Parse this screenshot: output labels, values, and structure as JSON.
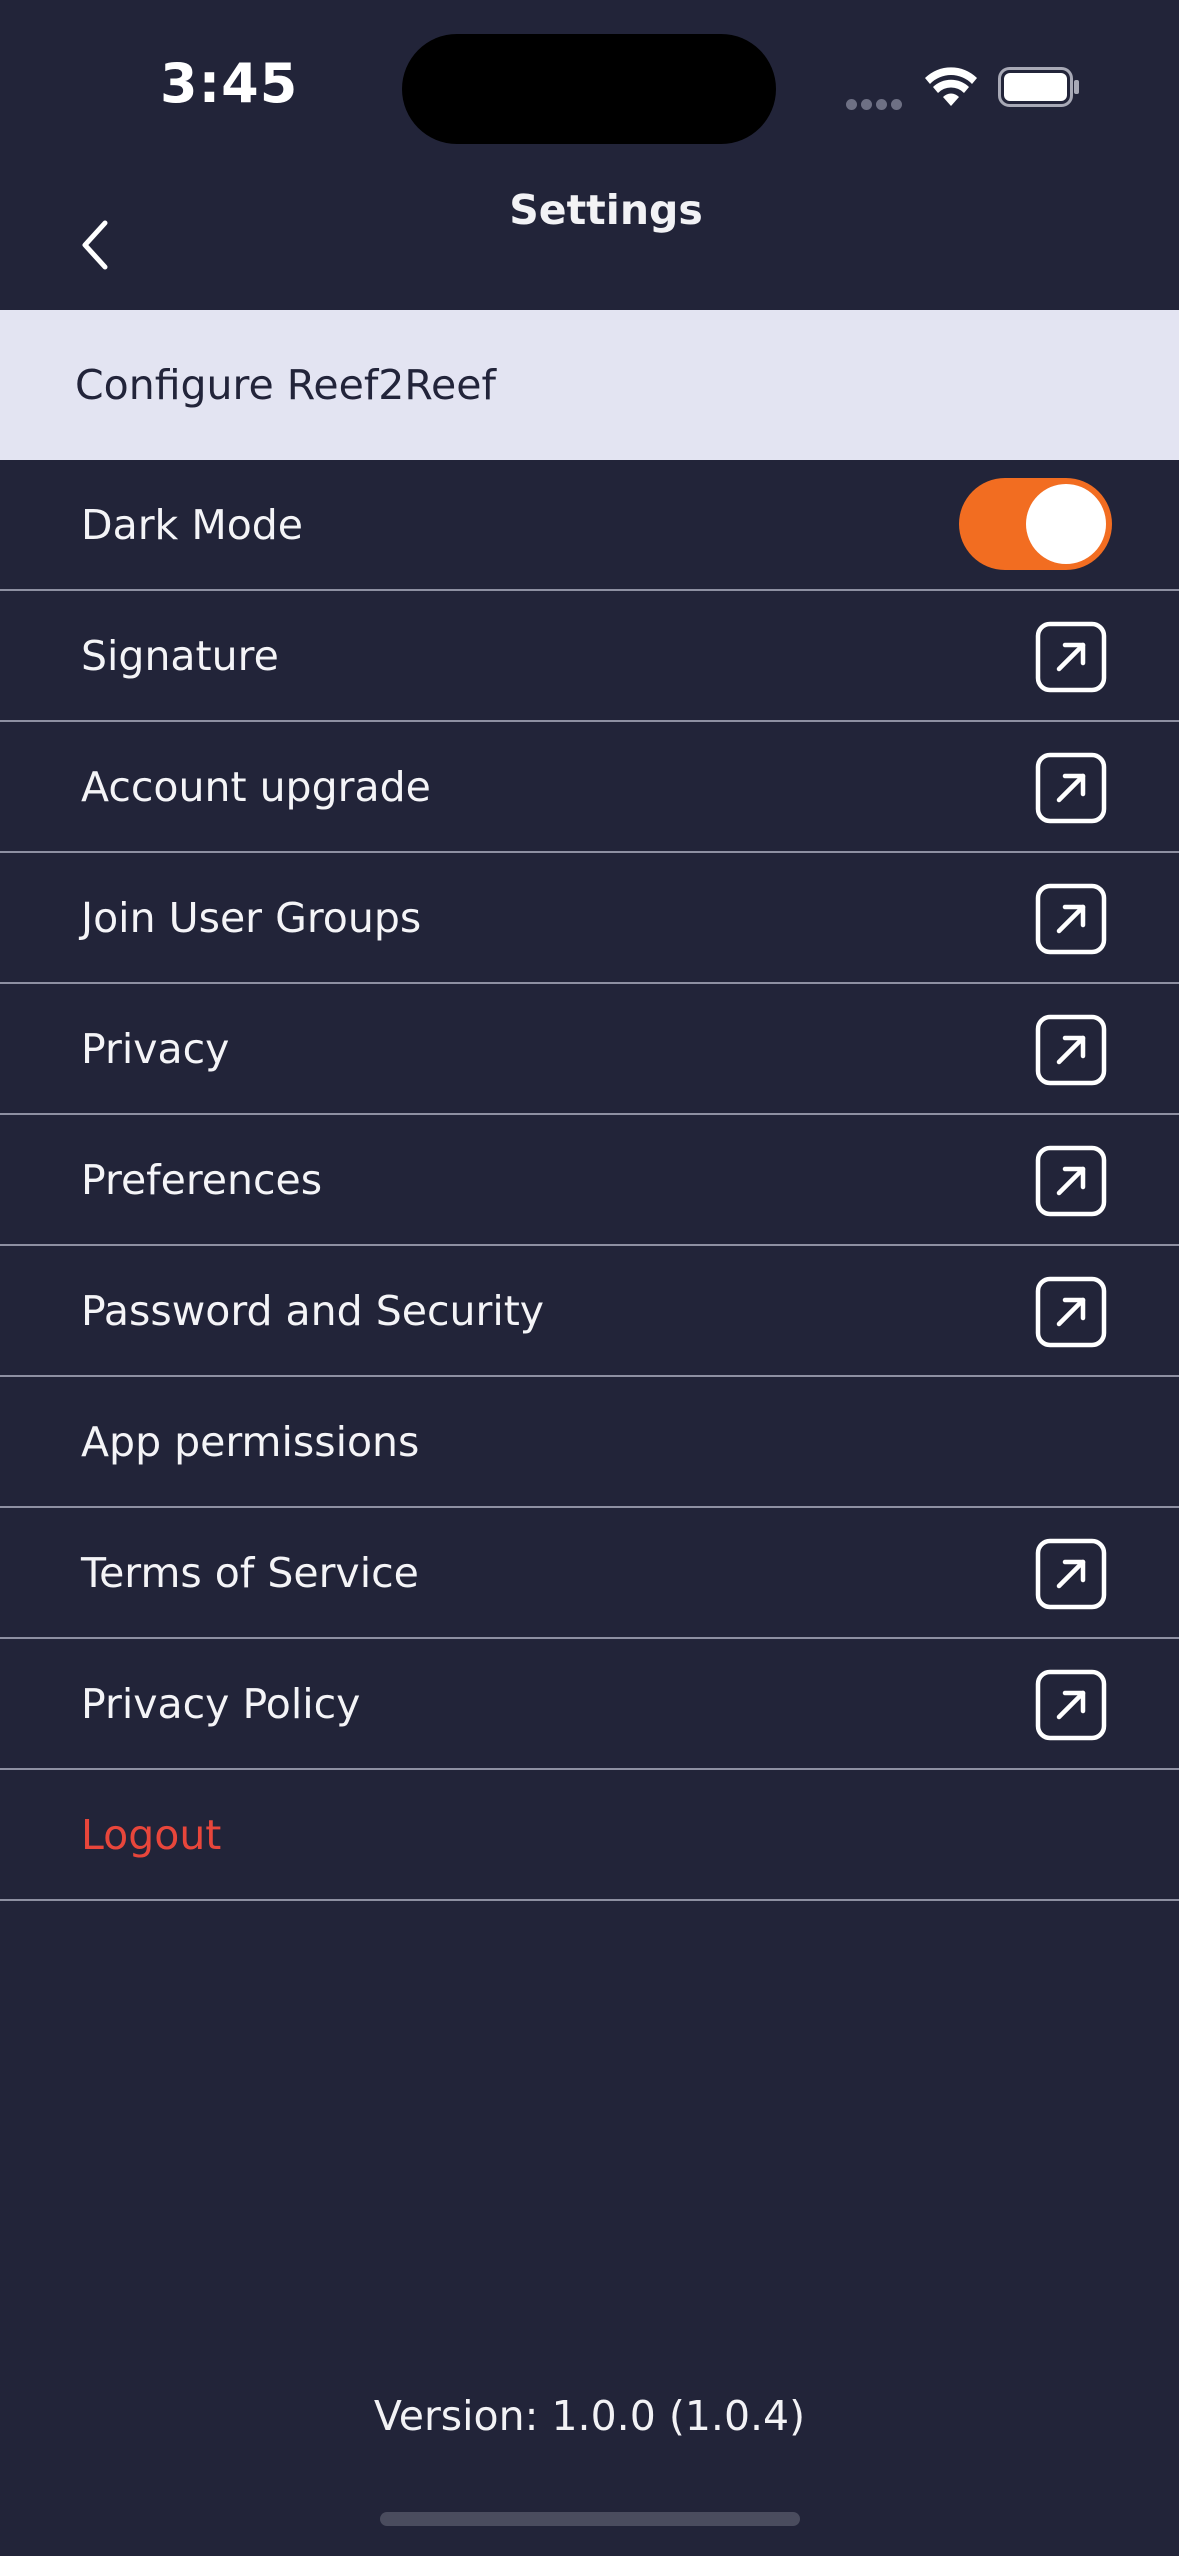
{
  "status_bar": {
    "time": "3:45"
  },
  "header": {
    "title": "Settings",
    "back_icon": "chevron-left-icon"
  },
  "section": {
    "title": "Configure Reef2Reef"
  },
  "rows": [
    {
      "label": "Dark Mode",
      "control": "toggle",
      "on": true
    },
    {
      "label": "Signature",
      "control": "external-link"
    },
    {
      "label": "Account upgrade",
      "control": "external-link"
    },
    {
      "label": "Join User Groups",
      "control": "external-link"
    },
    {
      "label": "Privacy",
      "control": "external-link"
    },
    {
      "label": "Preferences",
      "control": "external-link"
    },
    {
      "label": "Password and Security",
      "control": "external-link"
    },
    {
      "label": "App permissions",
      "control": "none"
    },
    {
      "label": "Terms of Service",
      "control": "external-link"
    },
    {
      "label": "Privacy Policy",
      "control": "external-link"
    },
    {
      "label": "Logout",
      "control": "none",
      "destructive": true
    }
  ],
  "footer": {
    "version": "Version: 1.0.0 (1.0.4)"
  },
  "colors": {
    "background": "#222439",
    "section_bg": "#e3e4f2",
    "accent_toggle": "#f26d21",
    "logout": "#e8463b",
    "divider": "#8e90a2"
  }
}
